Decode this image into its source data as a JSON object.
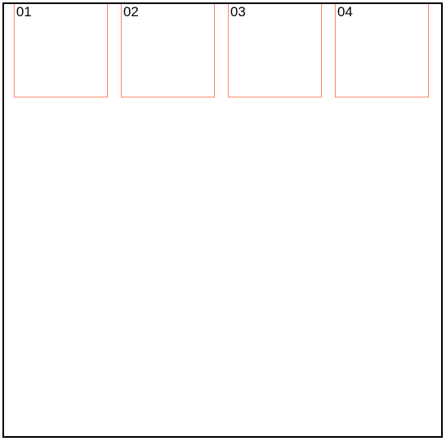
{
  "boxes": {
    "items": [
      {
        "label": "01"
      },
      {
        "label": "02"
      },
      {
        "label": "03"
      },
      {
        "label": "04"
      }
    ]
  },
  "colors": {
    "container_border": "#000000",
    "box_border": "#ff8566",
    "text": "#000000",
    "background": "#ffffff"
  }
}
